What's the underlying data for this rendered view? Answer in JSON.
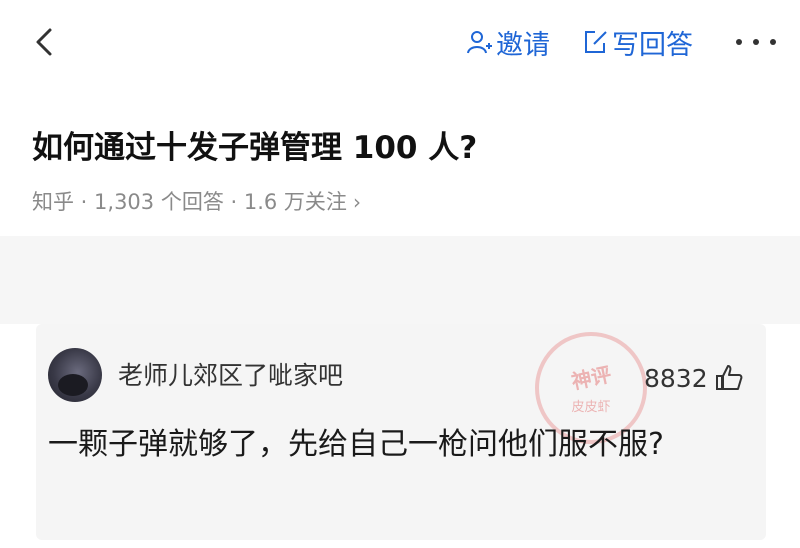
{
  "header": {
    "back_icon": "chevron-left-icon",
    "invite_label": "邀请",
    "invite_icon": "person-plus-icon",
    "write_label": "写回答",
    "write_icon": "edit-icon",
    "more_icon": "more-dots-icon",
    "accent_color": "#1f66d6"
  },
  "question": {
    "title": "如何通过十发子弹管理 100 人?",
    "source": "知乎",
    "sep1": " · ",
    "answers": "1,303 个回答",
    "sep2": " · ",
    "followers": "1.6 万关注",
    "chevron": "›"
  },
  "answer": {
    "author": "老师儿郊区了呲家吧",
    "likes": "8832",
    "like_icon": "thumbs-up-icon",
    "text": "一颗子弹就够了，先给自己一枪问他们服不服?",
    "watermark_line1": "神评",
    "watermark_line2": "皮皮虾"
  }
}
